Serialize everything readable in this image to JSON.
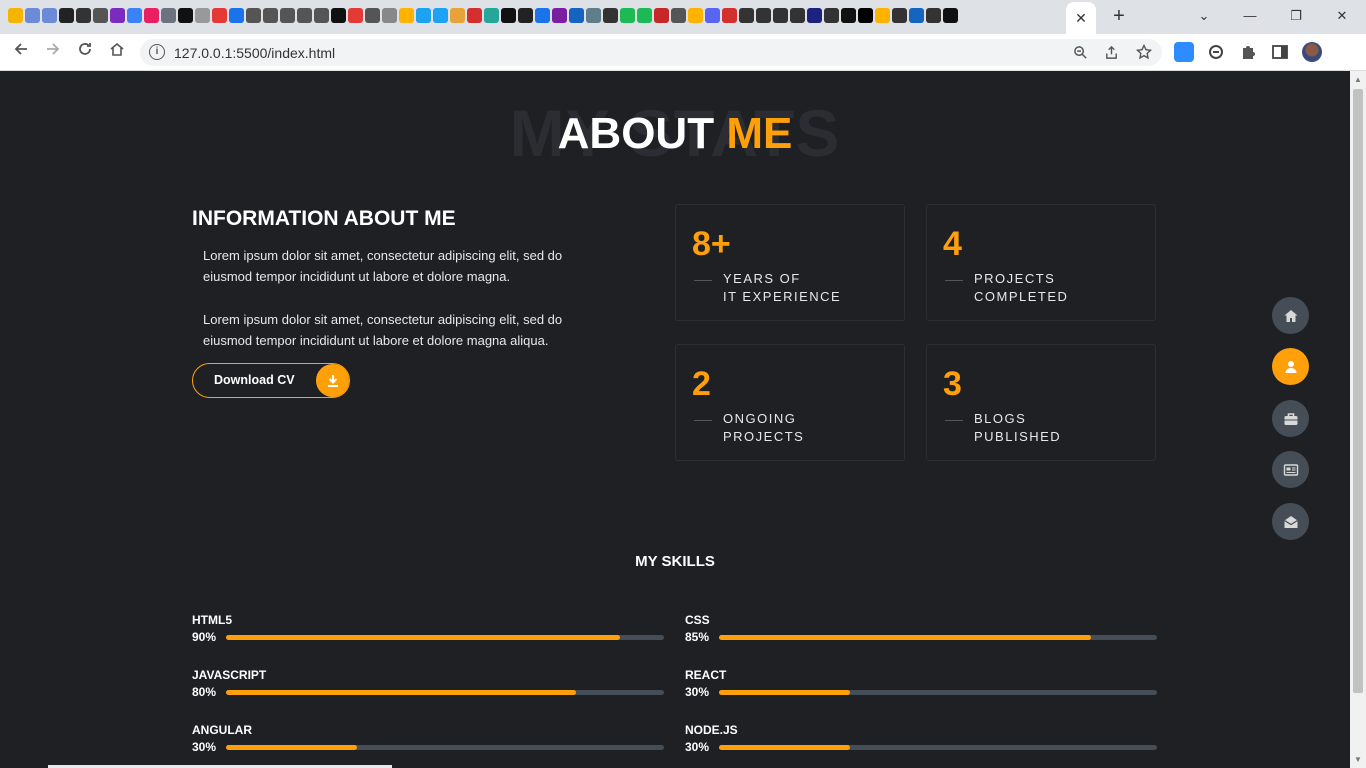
{
  "browser": {
    "url": "127.0.0.1:5500/index.html",
    "tab_close": "✕",
    "new_tab": "+",
    "window_controls": [
      "⌄",
      "—",
      "❐",
      "✕"
    ],
    "accent": "#ffa00a"
  },
  "page": {
    "bg_title": "MY STATS",
    "title_main": "ABOUT",
    "title_accent": "ME",
    "info_heading": "INFORMATION ABOUT ME",
    "para1": "Lorem ipsum dolor sit amet, consectetur adipiscing elit, sed do eiusmod tempor incididunt ut labore et dolore magna.",
    "para2": "Lorem ipsum dolor sit amet, consectetur adipiscing elit, sed do eiusmod tempor incididunt ut labore et dolore magna aliqua.",
    "cv_button": "Download CV",
    "stats": [
      {
        "number": "8+",
        "label": "YEARS OF\nIT EXPERIENCE"
      },
      {
        "number": "4",
        "label": "PROJECTS\nCOMPLETED"
      },
      {
        "number": "2",
        "label": "ONGOING\nPROJECTS"
      },
      {
        "number": "3",
        "label": "BLOGS\nPUBLISHED"
      }
    ],
    "skills_heading": "MY SKILLS",
    "skills": [
      {
        "name": "HTML5",
        "percent": "90%",
        "level": 0.9
      },
      {
        "name": "CSS",
        "percent": "85%",
        "level": 0.85
      },
      {
        "name": "JAVASCRIPT",
        "percent": "80%",
        "level": 0.8
      },
      {
        "name": "REACT",
        "percent": "30%",
        "level": 0.3
      },
      {
        "name": "ANGULAR",
        "percent": "30%",
        "level": 0.3
      },
      {
        "name": "NODE.JS",
        "percent": "30%",
        "level": 0.3
      }
    ],
    "side_nav": [
      "home-icon",
      "user-icon",
      "briefcase-icon",
      "newspaper-icon",
      "envelope-open-icon"
    ]
  }
}
